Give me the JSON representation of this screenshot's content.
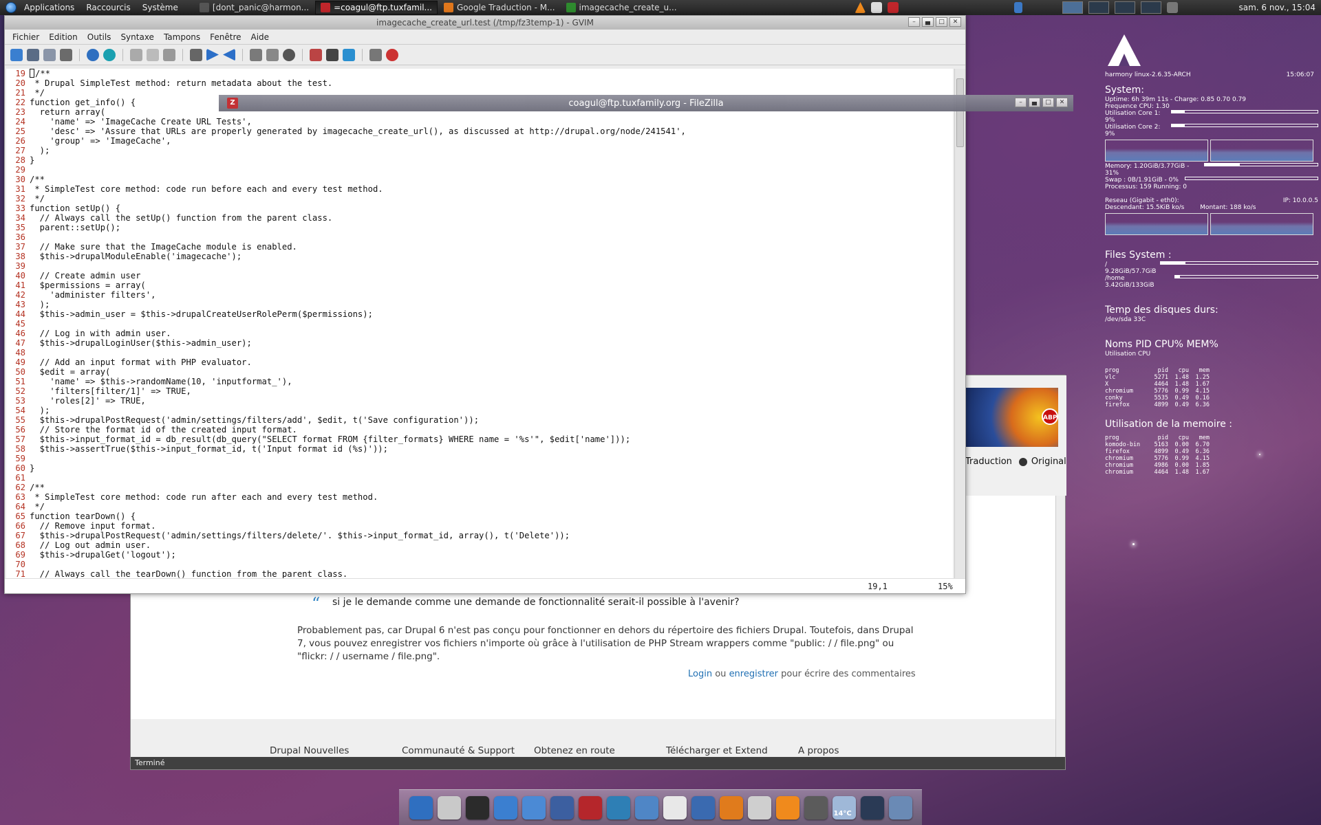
{
  "top_panel": {
    "menus": [
      "Applications",
      "Raccourcis",
      "Système"
    ],
    "tasks": [
      {
        "label": "[dont_panic@harmon...",
        "icon": "terminal-icon",
        "color": "#555555"
      },
      {
        "label": "=coagul@ftp.tuxfamil...",
        "icon": "filezilla-icon",
        "color": "#c0262b"
      },
      {
        "label": "Google Traduction - M...",
        "icon": "firefox-icon",
        "color": "#e0771c"
      },
      {
        "label": "imagecache_create_u...",
        "icon": "vim-icon",
        "color": "#2e8b2e"
      }
    ],
    "clock": "sam.  6 nov., 15:04"
  },
  "gvim": {
    "title": "imagecache_create_url.test (/tmp/fz3temp-1) - GVIM",
    "menu": [
      "Fichier",
      "Edition",
      "Outils",
      "Syntaxe",
      "Tampons",
      "Fenêtre",
      "Aide"
    ],
    "lines": [
      {
        "n": "19",
        "t": "/**"
      },
      {
        "n": "20",
        "t": " * Drupal SimpleTest method: return metadata about the test."
      },
      {
        "n": "21",
        "t": " */"
      },
      {
        "n": "22",
        "t": "function get_info() {"
      },
      {
        "n": "23",
        "t": "  return array("
      },
      {
        "n": "24",
        "t": "    'name' => 'ImageCache Create URL Tests',"
      },
      {
        "n": "25",
        "t": "    'desc' => 'Assure that URLs are properly generated by imagecache_create_url(), as discussed at http://drupal.org/node/241541',"
      },
      {
        "n": "26",
        "t": "    'group' => 'ImageCache',"
      },
      {
        "n": "27",
        "t": "  );"
      },
      {
        "n": "28",
        "t": "}"
      },
      {
        "n": "29",
        "t": ""
      },
      {
        "n": "30",
        "t": "/**"
      },
      {
        "n": "31",
        "t": " * SimpleTest core method: code run before each and every test method."
      },
      {
        "n": "32",
        "t": " */"
      },
      {
        "n": "33",
        "t": "function setUp() {"
      },
      {
        "n": "34",
        "t": "  // Always call the setUp() function from the parent class."
      },
      {
        "n": "35",
        "t": "  parent::setUp();"
      },
      {
        "n": "36",
        "t": ""
      },
      {
        "n": "37",
        "t": "  // Make sure that the ImageCache module is enabled."
      },
      {
        "n": "38",
        "t": "  $this->drupalModuleEnable('imagecache');"
      },
      {
        "n": "39",
        "t": ""
      },
      {
        "n": "40",
        "t": "  // Create admin user"
      },
      {
        "n": "41",
        "t": "  $permissions = array("
      },
      {
        "n": "42",
        "t": "    'administer filters',"
      },
      {
        "n": "43",
        "t": "  );"
      },
      {
        "n": "44",
        "t": "  $this->admin_user = $this->drupalCreateUserRolePerm($permissions);"
      },
      {
        "n": "45",
        "t": ""
      },
      {
        "n": "46",
        "t": "  // Log in with admin user."
      },
      {
        "n": "47",
        "t": "  $this->drupalLoginUser($this->admin_user);"
      },
      {
        "n": "48",
        "t": ""
      },
      {
        "n": "49",
        "t": "  // Add an input format with PHP evaluator."
      },
      {
        "n": "50",
        "t": "  $edit = array("
      },
      {
        "n": "51",
        "t": "    'name' => $this->randomName(10, 'inputformat_'),"
      },
      {
        "n": "52",
        "t": "    'filters[filter/1]' => TRUE,"
      },
      {
        "n": "53",
        "t": "    'roles[2]' => TRUE,"
      },
      {
        "n": "54",
        "t": "  );"
      },
      {
        "n": "55",
        "t": "  $this->drupalPostRequest('admin/settings/filters/add', $edit, t('Save configuration'));"
      },
      {
        "n": "56",
        "t": "  // Store the format id of the created input format."
      },
      {
        "n": "57",
        "t": "  $this->input_format_id = db_result(db_query(\"SELECT format FROM {filter_formats} WHERE name = '%s'\", $edit['name']));"
      },
      {
        "n": "58",
        "t": "  $this->assertTrue($this->input_format_id, t('Input format id (%s)'));"
      },
      {
        "n": "59",
        "t": ""
      },
      {
        "n": "60",
        "t": "}"
      },
      {
        "n": "61",
        "t": ""
      },
      {
        "n": "62",
        "t": "/**"
      },
      {
        "n": "63",
        "t": " * SimpleTest core method: code run after each and every test method."
      },
      {
        "n": "64",
        "t": " */"
      },
      {
        "n": "65",
        "t": "function tearDown() {"
      },
      {
        "n": "66",
        "t": "  // Remove input format."
      },
      {
        "n": "67",
        "t": "  $this->drupalPostRequest('admin/settings/filters/delete/'. $this->input_format_id, array(), t('Delete'));"
      },
      {
        "n": "68",
        "t": "  // Log out admin user."
      },
      {
        "n": "69",
        "t": "  $this->drupalGet('logout');"
      },
      {
        "n": "70",
        "t": ""
      },
      {
        "n": "71",
        "t": "  // Always call the tearDown() function from the parent class."
      }
    ],
    "status": {
      "position": "19,1",
      "percent": "15%"
    }
  },
  "filezilla": {
    "title": "coagul@ftp.tuxfamily.org - FileZilla"
  },
  "browser": {
    "translate_option": "Traduction",
    "original_option": "Original",
    "quote": "si je le demande comme une demande de fonctionnalité serait-il possible à l'avenir?",
    "paragraph": "Probablement pas, car Drupal 6 n'est pas conçu pour fonctionner en dehors du répertoire des fichiers Drupal. Toutefois, dans Drupal 7, vous pouvez enregistrer vos fichiers n'importe où grâce à l'utilisation de PHP Stream wrappers comme \"public: / / file.png\" ou \"flickr: / / username / file.png\".",
    "login": "Login",
    "or": "ou",
    "register": "enregistrer",
    "comment_suffix": "pour écrire des commentaires",
    "footer": [
      "Drupal Nouvelles",
      "Communauté & Support",
      "Obtenez en route",
      "Télécharger et Extend",
      "A propos"
    ],
    "status": "Terminé"
  },
  "conky": {
    "host": "harmony linux-2.6.35-ARCH",
    "time": "15:06:07",
    "system_title": "System:",
    "uptime": "Uptime: 6h 39m 11s - Charge: 0.85 0.70 0.79",
    "freq": "Frequence CPU: 1.30",
    "core1": "Utilisation Core 1: 9%",
    "core1_pct": 9,
    "core2": "Utilisation Core 2: 9%",
    "core2_pct": 9,
    "memory": "Memory: 1.20GiB/3.77GiB - 31%",
    "memory_pct": 31,
    "swap": "Swap : 0B/1.91GiB - 0%",
    "processes": "Processus: 159  Running: 0",
    "net": "Reseau (Gigabit - eth0):",
    "ip": "IP: 10.0.0.5",
    "down": "Descendant: 15.5KiB ko/s",
    "up": "Montant: 188 ko/s",
    "fs_title": "Files System :",
    "fs_root": "/ 9.28GiB/57.7GiB",
    "fs_root_pct": 16,
    "fs_home": "/home 3.42GiB/133GiB",
    "fs_home_pct": 3,
    "temp_title": "Temp des disques durs:",
    "temp_sda": "/dev/sda 33C",
    "proc_title": "Noms PID CPU% MEM%",
    "proc_sub": "Utilisation CPU",
    "proc_header": [
      "prog",
      "pid",
      "cpu",
      "mem"
    ],
    "proc_cpu": [
      [
        "vlc",
        "5271",
        "1.48",
        "1.25"
      ],
      [
        "X",
        "4464",
        "1.48",
        "1.67"
      ],
      [
        "chromium",
        "5776",
        "0.99",
        "4.15"
      ],
      [
        "conky",
        "5535",
        "0.49",
        "0.16"
      ],
      [
        "firefox",
        "4899",
        "0.49",
        "6.36"
      ]
    ],
    "mem_title": "Utilisation de la memoire :",
    "proc_mem": [
      [
        "komodo-bin",
        "5163",
        "0.00",
        "6.70"
      ],
      [
        "firefox",
        "4899",
        "0.49",
        "6.36"
      ],
      [
        "chromium",
        "5776",
        "0.99",
        "4.15"
      ],
      [
        "chromium",
        "4986",
        "0.00",
        "1.85"
      ],
      [
        "chromium",
        "4464",
        "1.48",
        "1.67"
      ]
    ]
  },
  "dock": {
    "weather": "14°C",
    "icons": [
      {
        "name": "globe-icon",
        "color": "#2f6fc0"
      },
      {
        "name": "files-icon",
        "color": "#c9c9c9"
      },
      {
        "name": "terminal-icon",
        "color": "#2b2b2b"
      },
      {
        "name": "web-icon",
        "color": "#3b7fd0"
      },
      {
        "name": "music-icon",
        "color": "#4b8ad5"
      },
      {
        "name": "mail-icon",
        "color": "#3c5fa0"
      },
      {
        "name": "filezilla-icon",
        "color": "#b5262b"
      },
      {
        "name": "earth-icon",
        "color": "#2e7fb5"
      },
      {
        "name": "box-icon",
        "color": "#4f86c6"
      },
      {
        "name": "text-editor-icon",
        "color": "#e8e8e8"
      },
      {
        "name": "bird-icon",
        "color": "#3a6ab0"
      },
      {
        "name": "blender-icon",
        "color": "#e07b1c"
      },
      {
        "name": "disc-icon",
        "color": "#cfcfcf"
      },
      {
        "name": "vlc-icon",
        "color": "#f08a1c"
      },
      {
        "name": "monitor-icon",
        "color": "#5b5b5b"
      },
      {
        "name": "weather-icon",
        "color": "#9fb8d8"
      },
      {
        "name": "desktop-icon",
        "color": "#2a3a55"
      },
      {
        "name": "trash-icon",
        "color": "#6a8ab5"
      }
    ]
  }
}
